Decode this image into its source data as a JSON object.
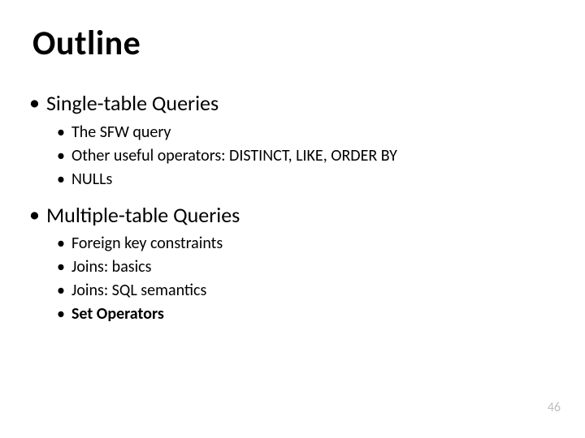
{
  "title": "Outline",
  "items": [
    {
      "label": "Single-table  Queries",
      "bold": false,
      "sub": [
        {
          "label": "The  SFW  query",
          "bold": false
        },
        {
          "label": "Other  useful  operators:  DISTINCT,  LIKE,  ORDER  BY",
          "bold": false
        },
        {
          "label": "NULLs",
          "bold": false
        }
      ]
    },
    {
      "label": "Multiple-table  Queries",
      "bold": false,
      "sub": [
        {
          "label": "Foreign  key  constraints",
          "bold": false
        },
        {
          "label": "Joins:  basics",
          "bold": false
        },
        {
          "label": "Joins:  SQL  semantics",
          "bold": false
        },
        {
          "label": "Set Operators",
          "bold": true
        }
      ]
    }
  ],
  "page_number": "46",
  "bullet_glyph": "•"
}
